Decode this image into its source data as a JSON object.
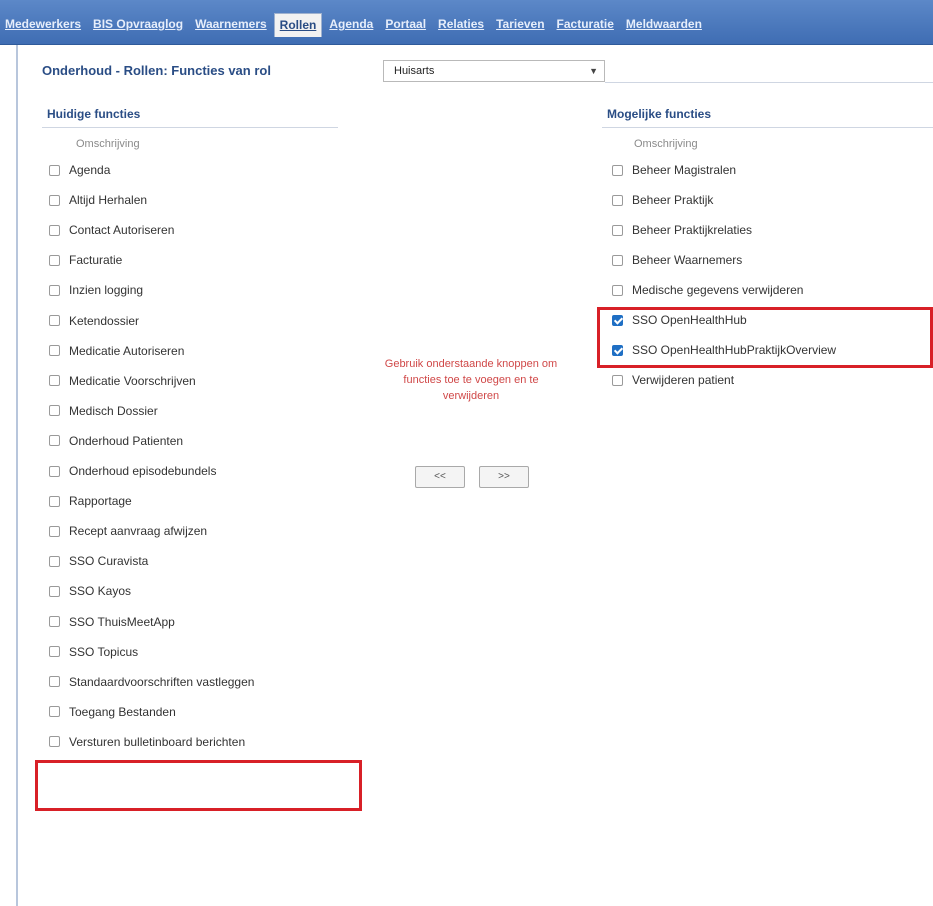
{
  "nav": {
    "tabs": [
      {
        "label": "Medewerkers"
      },
      {
        "label": "BIS Opvraaglog"
      },
      {
        "label": "Waarnemers"
      },
      {
        "label": "Rollen"
      },
      {
        "label": "Agenda"
      },
      {
        "label": "Portaal"
      },
      {
        "label": "Relaties"
      },
      {
        "label": "Tarieven"
      },
      {
        "label": "Facturatie"
      },
      {
        "label": "Meldwaarden"
      }
    ],
    "active": "Rollen"
  },
  "header": {
    "title": "Onderhoud - Rollen: Functies van rol",
    "role_value": "Huisarts"
  },
  "current": {
    "title": "Huidige functies",
    "column_header": "Omschrijving",
    "items": [
      {
        "label": "Agenda",
        "checked": false
      },
      {
        "label": "Altijd Herhalen",
        "checked": false
      },
      {
        "label": "Contact Autoriseren",
        "checked": false
      },
      {
        "label": "Facturatie",
        "checked": false
      },
      {
        "label": "Inzien logging",
        "checked": false
      },
      {
        "label": "Ketendossier",
        "checked": false
      },
      {
        "label": "Medicatie Autoriseren",
        "checked": false
      },
      {
        "label": "Medicatie Voorschrijven",
        "checked": false
      },
      {
        "label": "Medisch Dossier",
        "checked": false
      },
      {
        "label": "Onderhoud Patienten",
        "checked": false
      },
      {
        "label": "Onderhoud episodebundels",
        "checked": false
      },
      {
        "label": "Rapportage",
        "checked": false
      },
      {
        "label": "Recept aanvraag afwijzen",
        "checked": false
      },
      {
        "label": "SSO Curavista",
        "checked": false
      },
      {
        "label": "SSO Kayos",
        "checked": false
      },
      {
        "label": "SSO ThuisMeetApp",
        "checked": false
      },
      {
        "label": "SSO Topicus",
        "checked": false
      },
      {
        "label": "Standaardvoorschriften vastleggen",
        "checked": false
      },
      {
        "label": "Toegang Bestanden",
        "checked": false
      },
      {
        "label": "Versturen bulletinboard berichten",
        "checked": false
      }
    ]
  },
  "possible": {
    "title": "Mogelijke functies",
    "column_header": "Omschrijving",
    "items": [
      {
        "label": "Beheer Magistralen",
        "checked": false
      },
      {
        "label": "Beheer Praktijk",
        "checked": false
      },
      {
        "label": "Beheer Praktijkrelaties",
        "checked": false
      },
      {
        "label": "Beheer Waarnemers",
        "checked": false
      },
      {
        "label": "Medische gegevens verwijderen",
        "checked": false
      },
      {
        "label": "SSO OpenHealthHub",
        "checked": true
      },
      {
        "label": "SSO OpenHealthHubPraktijkOverview",
        "checked": true
      },
      {
        "label": "Verwijderen patient",
        "checked": false
      }
    ]
  },
  "instruction": "Gebruik onderstaande knoppen om functies toe te voegen en te verwijderen",
  "buttons": {
    "add_label": "<<",
    "remove_label": ">>"
  },
  "colors": {
    "nav_bg": "#4a78bd",
    "heading": "#2a4d85",
    "highlight": "#d82027",
    "instruction": "#d04848",
    "check": "#1f6fc4"
  }
}
